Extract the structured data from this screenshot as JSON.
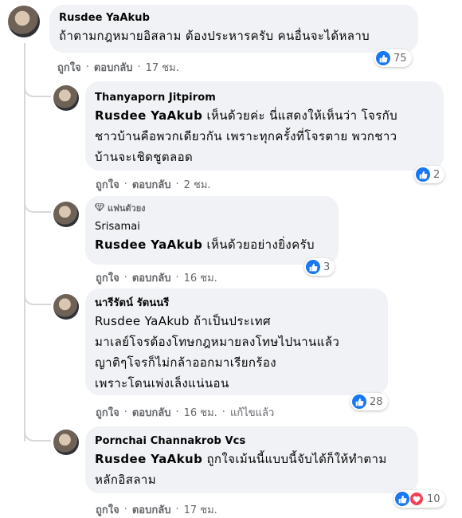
{
  "comments": [
    {
      "author": "Rusdee YaAkub",
      "lines": [
        "ถ้าตามกฎหมายอิสลาม ต้องประหารครับ คนอื่นจะได้หลาบ"
      ],
      "reaction_count": "75",
      "like": "ถูกใจ",
      "reply": "ตอบกลับ",
      "time": "17 ชม."
    },
    {
      "author": "Thanyaporn Jitpirom",
      "tag": "Rusdee YaAkub",
      "lines": [
        "เห็นด้วยค่ะ นี่แสดงให้เห็นว่า โจรกับ",
        "ชาวบ้านคือพวกเดียวกัน เพราะทุกครั้งที่โจรตาย พวกชาว",
        "บ้านจะเชิดชูตลอด"
      ],
      "reaction_count": "2",
      "like": "ถูกใจ",
      "reply": "ตอบกลับ",
      "time": "2 ชม."
    },
    {
      "badge": "แฟนตัวยง",
      "author": "Srisamai",
      "tag": "Rusdee YaAkub",
      "lines": [
        "เห็นด้วยอย่างยิ่งครับ"
      ],
      "reaction_count": "3",
      "like": "ถูกใจ",
      "reply": "ตอบกลับ",
      "time": "16 ชม."
    },
    {
      "author": "นารีรัตน์ รัตนนรี",
      "lines": [
        "Rusdee YaAkub ถ้าเป็นประเทศ",
        "มาเลย์โจรต้องโทษกฎหมายลงโทษไปนานแล้ว",
        "ญาติๆโจรก็ไม่กล้าออกมาเรียกร้อง",
        "เพราะโดนเพ่งเล็งแน่นอน"
      ],
      "reaction_count": "28",
      "like": "ถูกใจ",
      "reply": "ตอบกลับ",
      "time": "16 ชม.",
      "edited": "แก้ไขแล้ว"
    },
    {
      "author": "Pornchai Channakrob Vcs",
      "tag": "Rusdee YaAkub",
      "lines": [
        "ถูกใจเม้นนี้แบบนี้จับได้ก็ให้ทำตาม",
        "หลักอิสลาม"
      ],
      "reaction_count": "10",
      "like": "ถูกใจ",
      "reply": "ตอบกลับ",
      "time": "17 ชม."
    }
  ],
  "colors": {
    "bubble": "#f0f2f5",
    "secondary_text": "#65676b",
    "like_blue": "#1877f2",
    "love_red": "#f33e58"
  },
  "icons": {
    "like": "thumbs-up-icon",
    "love": "heart-icon",
    "badge": "diamond-icon"
  }
}
